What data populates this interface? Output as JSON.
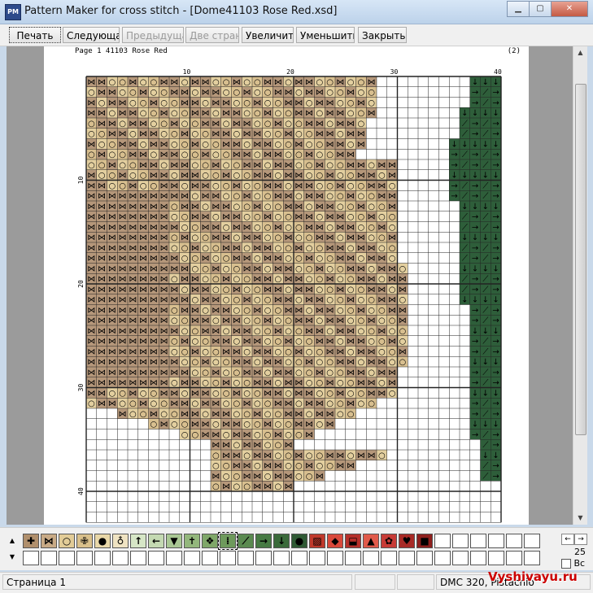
{
  "window": {
    "title": "Pattern Maker for cross stitch - [Dome41103 Rose Red.xsd]",
    "app_icon_text": "PM"
  },
  "toolbar": [
    {
      "label": "Печать",
      "state": "active"
    },
    {
      "label": "Следующая",
      "state": "normal"
    },
    {
      "label": "Предыдущая",
      "state": "disabled"
    },
    {
      "label": "Две страницы",
      "state": "disabled"
    },
    {
      "label": "Увеличить",
      "state": "normal"
    },
    {
      "label": "Уменьшить",
      "state": "normal"
    },
    {
      "label": "Закрыть",
      "state": "normal"
    }
  ],
  "page": {
    "header": "Page 1   41103 Rose Red",
    "number": "(2)",
    "column_ticks": [
      "10",
      "20",
      "30",
      "40"
    ],
    "row_ticks": [
      "10",
      "20",
      "30",
      "40"
    ]
  },
  "colors": {
    "tan": "#b5977a",
    "light_tan": "#e3cf9f",
    "dark_green": "#2e5e3a",
    "grid": "#222222"
  },
  "palette": {
    "items": [
      {
        "symbol": "✚",
        "color": "#b08f6c",
        "icon": "cross-icon"
      },
      {
        "symbol": "⋈",
        "color": "#c8aa86",
        "icon": "bowtie-icon"
      },
      {
        "symbol": "○",
        "color": "#e2cc97",
        "icon": "circle-icon"
      },
      {
        "symbol": "✙",
        "color": "#d9c08b",
        "icon": "plus-icon"
      },
      {
        "symbol": "●",
        "color": "#e8d7a8",
        "icon": "dot-icon"
      },
      {
        "symbol": "♁",
        "color": "#efe3c2",
        "icon": "drop-icon"
      },
      {
        "symbol": "↑",
        "color": "#d6e6c6",
        "icon": "arrow-up-icon"
      },
      {
        "symbol": "←",
        "color": "#c4d9b2",
        "icon": "arrow-left-icon"
      },
      {
        "symbol": "▼",
        "color": "#a9c793",
        "icon": "triangle-down-icon"
      },
      {
        "symbol": "✝",
        "color": "#93b77c",
        "icon": "cross-thin-icon"
      },
      {
        "symbol": "❖",
        "color": "#7fa769",
        "icon": "diamond-icon"
      },
      {
        "symbol": "⁞",
        "color": "#6e9a5c",
        "icon": "dots-icon"
      },
      {
        "symbol": "⟋",
        "color": "#5a8a50",
        "icon": "slash-icon"
      },
      {
        "symbol": "→",
        "color": "#467a43",
        "icon": "arrow-right-icon"
      },
      {
        "symbol": "↓",
        "color": "#3a6a3a",
        "icon": "arrow-down-icon"
      },
      {
        "symbol": "●",
        "color": "#2f5a34",
        "icon": "dot-dark-icon"
      },
      {
        "symbol": "▨",
        "color": "#c0392b",
        "icon": "hatch-icon"
      },
      {
        "symbol": "◆",
        "color": "#d8483a",
        "icon": "diamond-red-icon"
      },
      {
        "symbol": "⬓",
        "color": "#b5302a",
        "icon": "box-icon"
      },
      {
        "symbol": "▲",
        "color": "#e05a4a",
        "icon": "triangle-up-icon"
      },
      {
        "symbol": "✿",
        "color": "#c73b36",
        "icon": "flower-icon"
      },
      {
        "symbol": "♥",
        "color": "#a82a26",
        "icon": "heart-icon"
      },
      {
        "symbol": "■",
        "color": "#8e1f1d",
        "icon": "square-icon"
      }
    ],
    "empty_slots": 6,
    "count": "25",
    "checkbox_label": "Вс"
  },
  "status": {
    "page": "Страница 1",
    "thread": "DMC  320, Pistachio"
  },
  "watermark": "Vyshivayu.ru"
}
